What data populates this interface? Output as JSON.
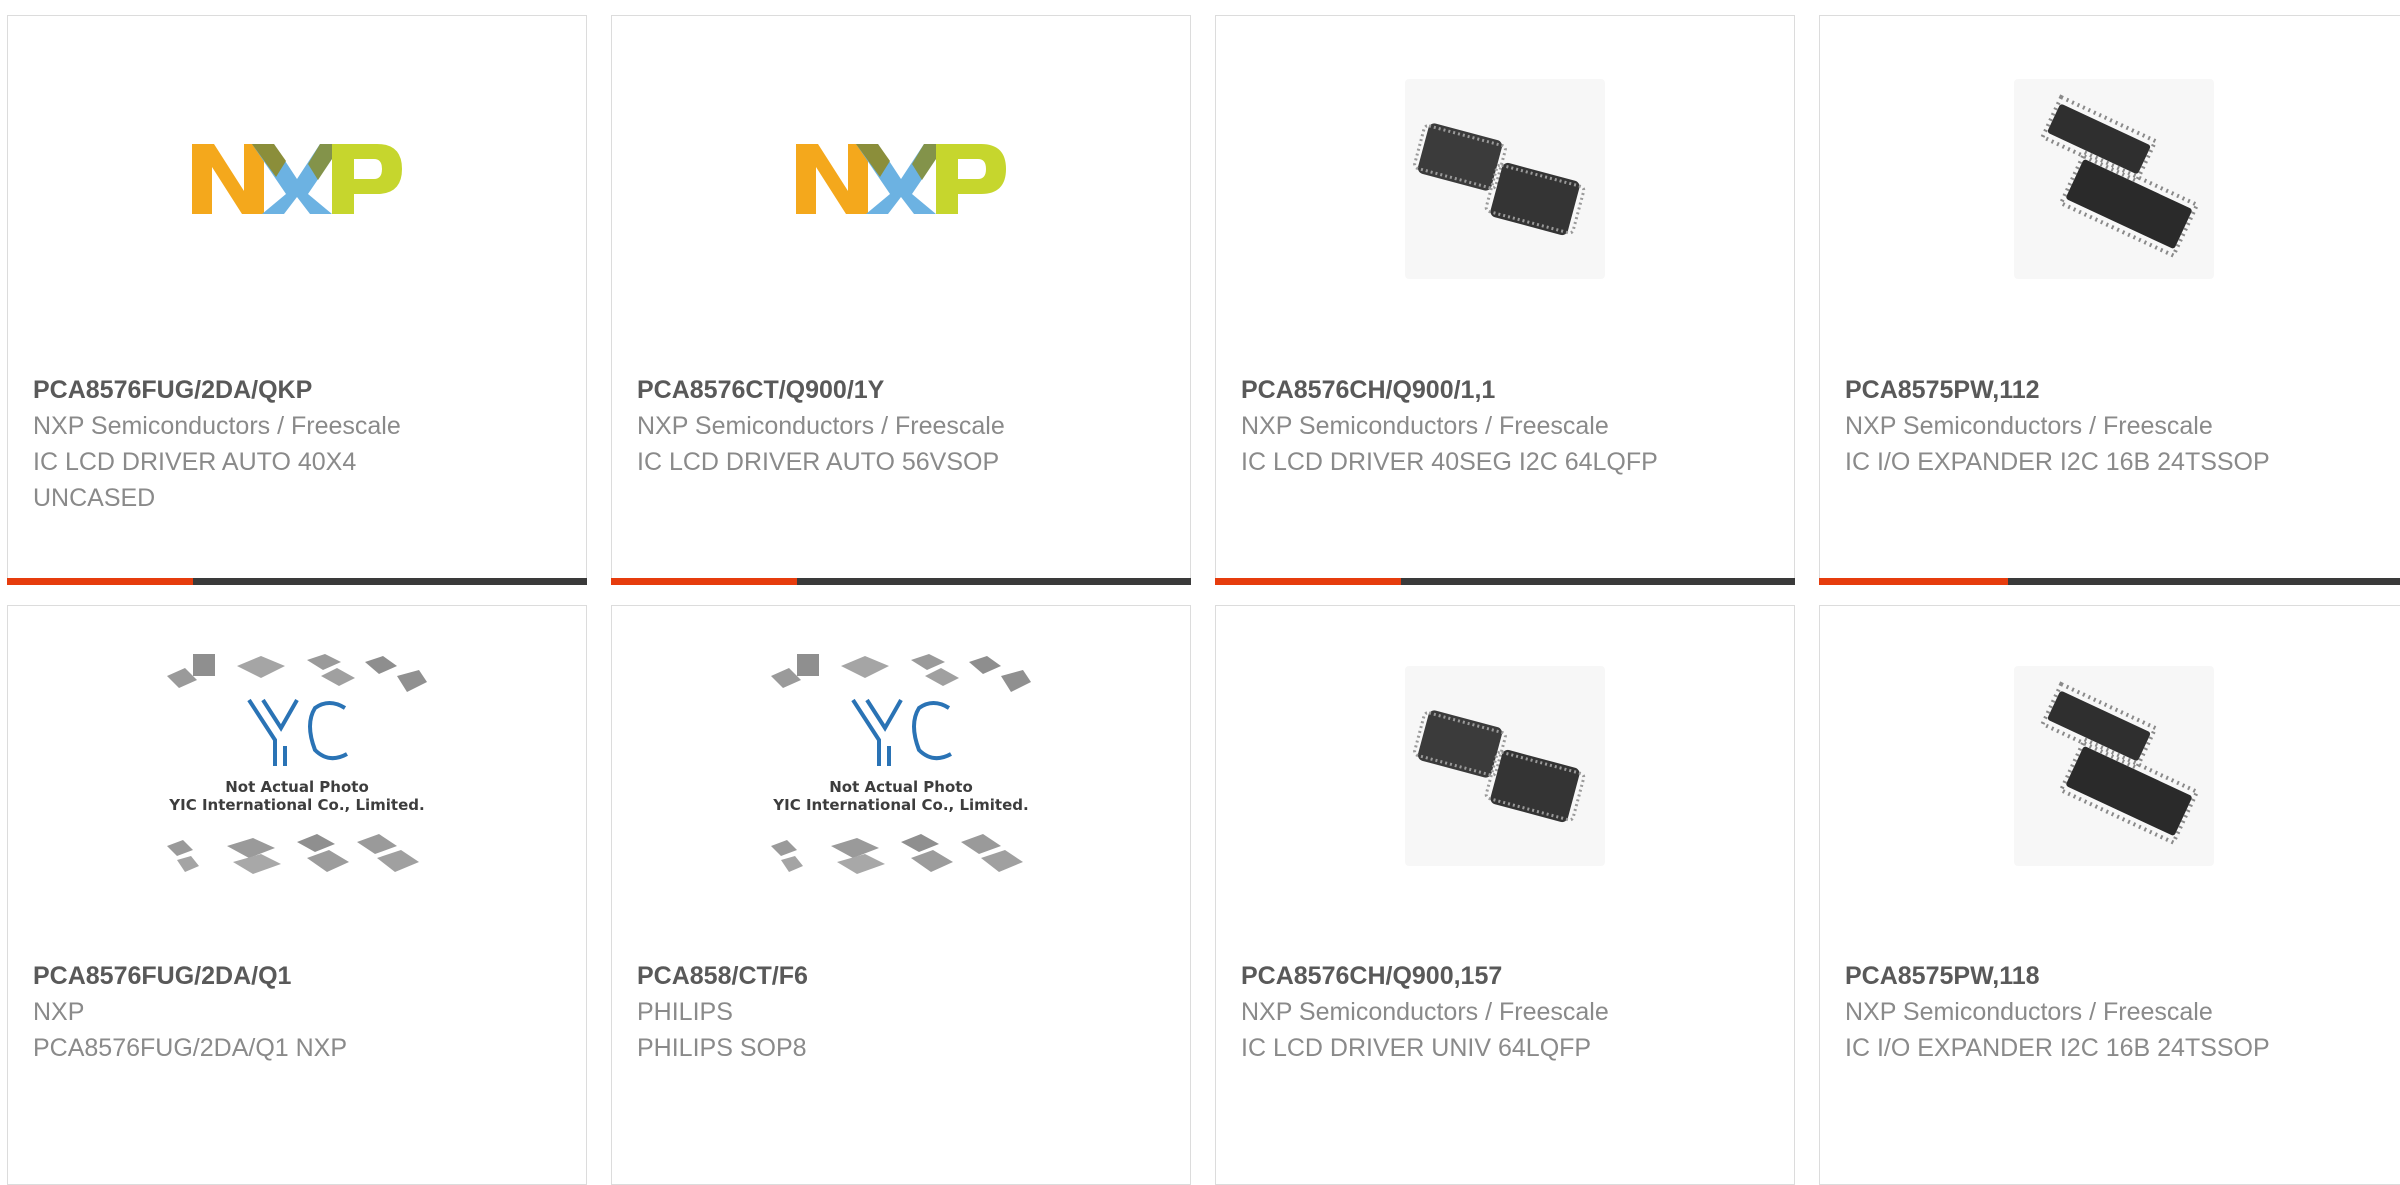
{
  "colors": {
    "accent": "#e63c0d",
    "progress_track": "#3a3a3a",
    "part_text": "#595959",
    "secondary_text": "#8a8a8a",
    "card_border": "#dcdcdc"
  },
  "cards": [
    {
      "part_number": "PCA8576FUG/2DA/QKP",
      "manufacturer": "NXP Semiconductors / Freescale",
      "description": "IC LCD DRIVER AUTO 40X4 UNCASED",
      "image": "nxp-logo",
      "logo_text": "NXP",
      "progress": 0.32
    },
    {
      "part_number": "PCA8576CT/Q900/1Y",
      "manufacturer": "NXP Semiconductors / Freescale",
      "description": "IC LCD DRIVER AUTO 56VSOP",
      "image": "nxp-logo",
      "logo_text": "NXP",
      "progress": 0.32
    },
    {
      "part_number": "PCA8576CH/Q900/1,1",
      "manufacturer": "NXP Semiconductors / Freescale",
      "description": "IC LCD DRIVER 40SEG I2C 64LQFP",
      "image": "lqfp-chip-photo",
      "progress": 0.32
    },
    {
      "part_number": "PCA8575PW,112",
      "manufacturer": "NXP Semiconductors / Freescale",
      "description": "IC I/O EXPANDER I2C 16B 24TSSOP",
      "image": "tssop-chip-photo",
      "progress": 0.32
    },
    {
      "part_number": "PCA8576FUG/2DA/Q1",
      "manufacturer": "NXP",
      "description": "PCA8576FUG/2DA/Q1 NXP",
      "image": "not-actual-photo",
      "placeholder_line1": "Not Actual Photo",
      "placeholder_line2": "YIC International Co., Limited.",
      "placeholder_logo": "YIC"
    },
    {
      "part_number": "PCA858/CT/F6",
      "manufacturer": "PHILIPS",
      "description": "PHILIPS SOP8",
      "image": "not-actual-photo",
      "placeholder_line1": "Not Actual Photo",
      "placeholder_line2": "YIC International Co., Limited.",
      "placeholder_logo": "YIC"
    },
    {
      "part_number": "PCA8576CH/Q900,157",
      "manufacturer": "NXP Semiconductors / Freescale",
      "description": "IC LCD DRIVER UNIV 64LQFP",
      "image": "lqfp-chip-photo"
    },
    {
      "part_number": "PCA8575PW,118",
      "manufacturer": "NXP Semiconductors / Freescale",
      "description": "IC I/O EXPANDER I2C 16B 24TSSOP",
      "image": "tssop-chip-photo"
    }
  ]
}
